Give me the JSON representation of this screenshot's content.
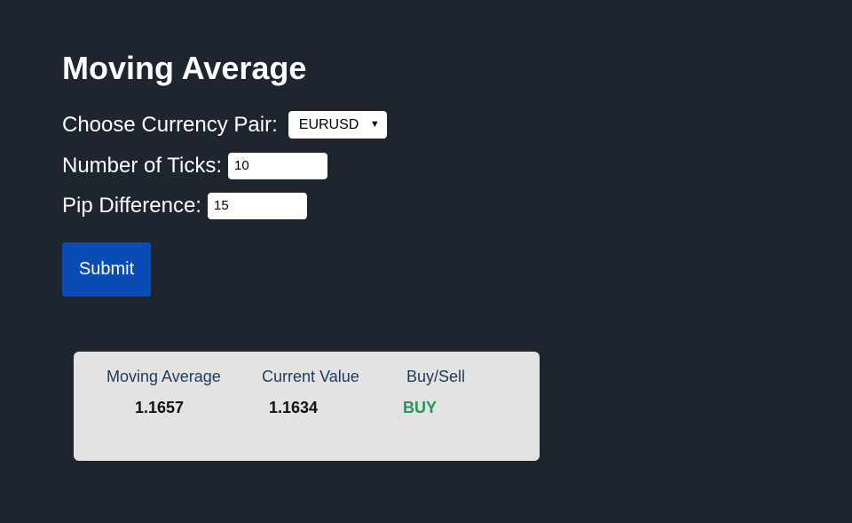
{
  "page": {
    "title": "Moving Average"
  },
  "form": {
    "currency_label": "Choose Currency Pair:",
    "currency_selected": "EURUSD",
    "ticks_label": "Number of Ticks:",
    "ticks_value": "10",
    "pip_label": "Pip Difference:",
    "pip_value": "15",
    "submit_label": "Submit"
  },
  "results": {
    "headers": {
      "moving_average": "Moving Average",
      "current_value": "Current Value",
      "buy_sell": "Buy/Sell"
    },
    "values": {
      "moving_average": "1.1657",
      "current_value": "1.1634",
      "buy_sell": "BUY"
    }
  },
  "colors": {
    "background": "#1f252e",
    "submit_button": "#0a4cb5",
    "results_panel": "#e3e3e3",
    "buy_signal": "#1f9a52"
  },
  "icons": {
    "select_caret": "chevron-down-icon"
  }
}
